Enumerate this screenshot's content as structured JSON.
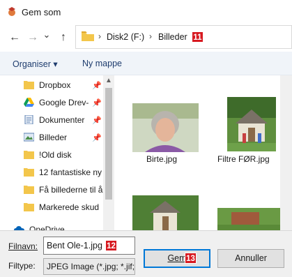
{
  "window": {
    "title": "Gem som"
  },
  "nav": {
    "back": "←",
    "forward": "→",
    "dropdown": "⌄",
    "up": "↑"
  },
  "address": {
    "separator": "›",
    "crumbs": [
      "Disk2 (F:)",
      "Billeder"
    ],
    "badge": "11"
  },
  "toolbar": {
    "organise": "Organiser ▾",
    "new_folder": "Ny mappe"
  },
  "sidebar": {
    "items": [
      {
        "label": "Dropbox",
        "pinned": true
      },
      {
        "label": "Google Drev-",
        "pinned": true
      },
      {
        "label": "Dokumenter",
        "pinned": true
      },
      {
        "label": "Billeder",
        "pinned": true
      },
      {
        "label": "!Old disk",
        "pinned": false
      },
      {
        "label": "12 fantastiske ny",
        "pinned": false
      },
      {
        "label": "Få billederne til å",
        "pinned": false
      },
      {
        "label": "Markerede skud",
        "pinned": false
      },
      {
        "label": "OneDrive",
        "pinned": false
      }
    ],
    "pin_glyph": "📌",
    "scroll_up": "▲"
  },
  "files": [
    {
      "name": "Birte.jpg"
    },
    {
      "name": "Filtre FØR.jpg"
    }
  ],
  "form": {
    "filename_label": "Filnavn:",
    "filename_value": "Bent Ole-1.jpg",
    "filename_badge": "12",
    "filetype_label": "Filtype:",
    "filetype_value": "JPEG Image (*.jpg; *.jif;",
    "save_button": "Gem",
    "save_badge": "13",
    "cancel_button": "Annuller"
  },
  "colors": {
    "badge": "#d71920",
    "accent": "#0078d7",
    "folder": "#f3c64b"
  }
}
